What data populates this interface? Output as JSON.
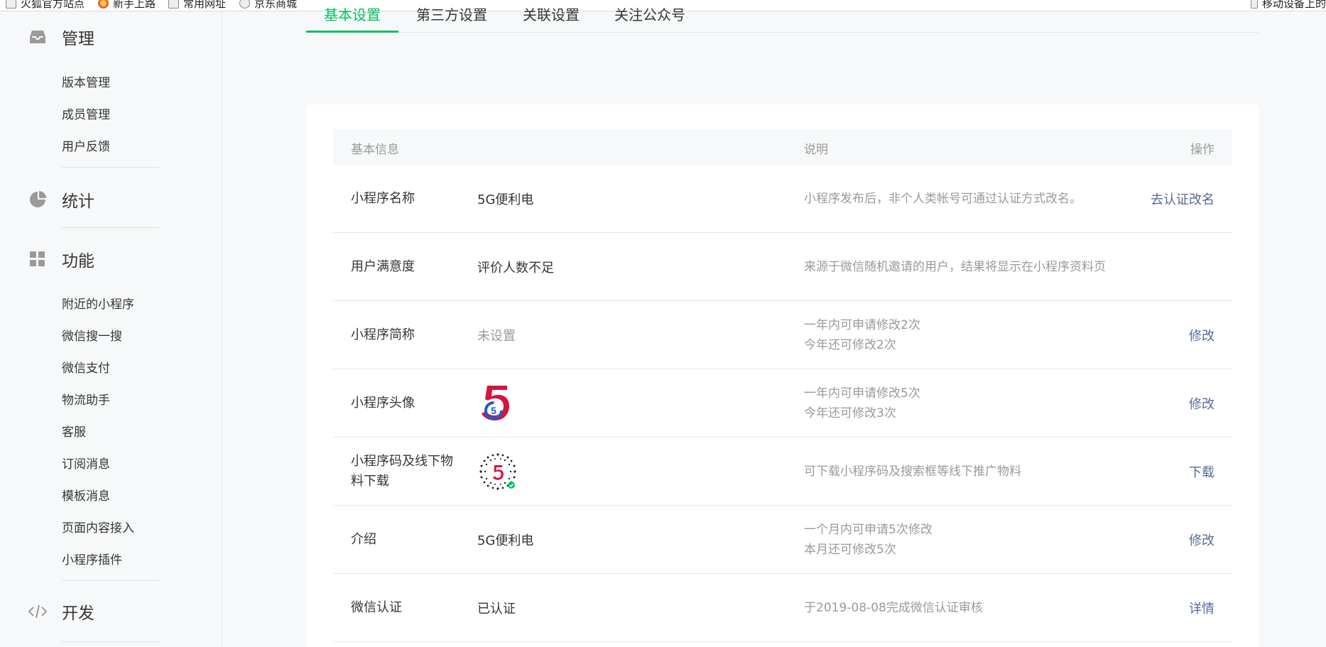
{
  "bookmarks": [
    {
      "label": "火狐官方站点",
      "icon": "page-icon"
    },
    {
      "label": "新手上路",
      "icon": "firefox-icon"
    },
    {
      "label": "常用网址",
      "icon": "folder-icon"
    },
    {
      "label": "京东商城",
      "icon": "globe-icon"
    }
  ],
  "bookmarks_right": {
    "label": "移动设备上的",
    "icon": "mobile-icon"
  },
  "sidebar": {
    "sections": [
      {
        "title": "管理",
        "icon": "inbox-icon",
        "items": [
          "版本管理",
          "成员管理",
          "用户反馈"
        ]
      },
      {
        "title": "统计",
        "icon": "pie-chart-icon",
        "items": []
      },
      {
        "title": "功能",
        "icon": "grid-icon",
        "items": [
          "附近的小程序",
          "微信搜一搜",
          "微信支付",
          "物流助手",
          "客服",
          "订阅消息",
          "模板消息",
          "页面内容接入",
          "小程序插件"
        ]
      },
      {
        "title": "开发",
        "icon": "code-icon",
        "items": []
      }
    ]
  },
  "tabs": [
    {
      "label": "基本设置",
      "active": true
    },
    {
      "label": "第三方设置",
      "active": false
    },
    {
      "label": "关联设置",
      "active": false
    },
    {
      "label": "关注公众号",
      "active": false
    }
  ],
  "table": {
    "headers": {
      "info": "基本信息",
      "desc": "说明",
      "op": "操作"
    },
    "rows": [
      {
        "label": "小程序名称",
        "value": "5G便利电",
        "desc": [
          "小程序发布后，非个人类帐号可通过认证方式改名。"
        ],
        "op": "去认证改名"
      },
      {
        "label": "用户满意度",
        "value": "评价人数不足",
        "desc": [
          "来源于微信随机邀请的用户，结果将显示在小程序资料页"
        ],
        "op": ""
      },
      {
        "label": "小程序简称",
        "value": "未设置",
        "desc": [
          "一年内可申请修改2次",
          "今年还可修改2次"
        ],
        "op": "修改"
      },
      {
        "label": "小程序头像",
        "value": "",
        "desc": [
          "一年内可申请修改5次",
          "今年还可修改3次"
        ],
        "op": "修改"
      },
      {
        "label": "小程序码及线下物料下载",
        "value": "",
        "desc": [
          "可下载小程序码及搜索框等线下推广物料"
        ],
        "op": "下载"
      },
      {
        "label": "介绍",
        "value": "5G便利电",
        "desc": [
          "一个月内可申请5次修改",
          "本月还可修改5次"
        ],
        "op": "修改"
      },
      {
        "label": "微信认证",
        "value": "已认证",
        "desc": [
          "于2019-08-08完成微信认证审核"
        ],
        "op": "详情"
      }
    ]
  },
  "logo_text": "5",
  "colors": {
    "accent": "#07c160",
    "link": "#576b95",
    "muted": "#9a9a9a",
    "logo_red": "#d6143c",
    "logo_blue": "#1e5bc6"
  }
}
